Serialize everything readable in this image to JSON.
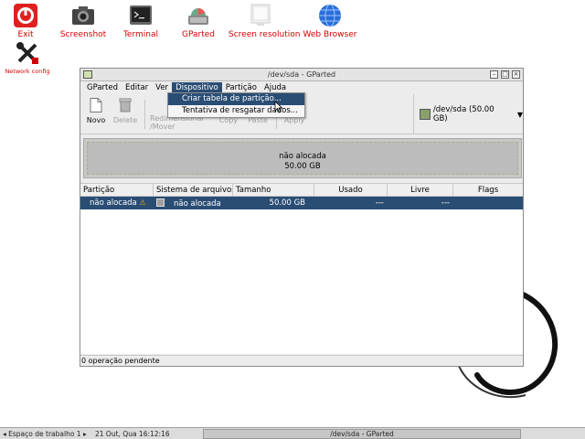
{
  "desktop": {
    "icons": [
      {
        "label": "Exit",
        "icon": "power-icon"
      },
      {
        "label": "Screenshot",
        "icon": "camera-icon"
      },
      {
        "label": "Terminal",
        "icon": "terminal-icon"
      },
      {
        "label": "GParted",
        "icon": "gparted-icon"
      },
      {
        "label": "Screen resolution",
        "icon": "monitor-icon"
      },
      {
        "label": "Web Browser",
        "icon": "globe-icon"
      },
      {
        "label": "Network config",
        "icon": "tools-icon"
      }
    ]
  },
  "window": {
    "title": "/dev/sda - GParted",
    "menu": [
      "GParted",
      "Editar",
      "Ver",
      "Dispositivo",
      "Partição",
      "Ajuda"
    ],
    "toolbar": {
      "new": "Novo",
      "delete": "Delete",
      "resize_line1": "Redimensionar",
      "resize_line2": "/Mover",
      "copy": "Copy",
      "paste": "Paste",
      "apply": "Apply"
    },
    "device_selector": "/dev/sda  (50.00 GB)",
    "disk_map": {
      "label": "não alocada",
      "size": "50.00 GB"
    },
    "dropdown": [
      "Criar tabela de partição...",
      "Tentativa de resgatar dados..."
    ],
    "table": {
      "headers": [
        "Partição",
        "Sistema de arquivos",
        "Tamanho",
        "Usado",
        "Livre",
        "Flags"
      ],
      "rows": [
        {
          "partition": "não alocada",
          "filesystem": "não alocada",
          "size": "50.00 GB",
          "used": "---",
          "free": "---",
          "flags": ""
        }
      ]
    },
    "status": "0 operação pendente"
  },
  "taskbar": {
    "workspace": "◂ Espaço de trabalho 1 ▸",
    "clock": "21 Out, Qua 16:12:16",
    "task": "/dev/sda - GParted"
  },
  "colors": {
    "selection": "#2a4d74",
    "desktop_label": "#d40000"
  }
}
